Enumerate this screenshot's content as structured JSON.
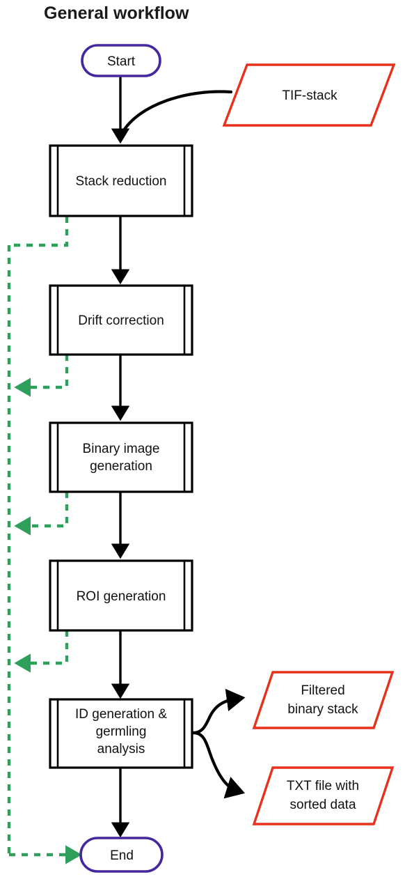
{
  "diagram": {
    "title": "General workflow",
    "type": "flowchart",
    "colors": {
      "terminator_border": "#4527a0",
      "process_border": "#000000",
      "io_border": "#e8301c",
      "loop_arrow": "#2ea05c",
      "background": "#ffffff",
      "text": "#111111"
    },
    "nodes": [
      {
        "id": "start",
        "shape": "terminator",
        "label": "Start"
      },
      {
        "id": "tif",
        "shape": "input-output",
        "label": "TIF-stack"
      },
      {
        "id": "reduce",
        "shape": "predefined-process",
        "label": "Stack reduction"
      },
      {
        "id": "drift",
        "shape": "predefined-process",
        "label": "Drift correction"
      },
      {
        "id": "binary",
        "shape": "predefined-process",
        "label_line1": "Binary image",
        "label_line2": "generation"
      },
      {
        "id": "roi",
        "shape": "predefined-process",
        "label": "ROI generation"
      },
      {
        "id": "idgen",
        "shape": "predefined-process",
        "label_line1": "ID generation &",
        "label_line2": "germling",
        "label_line3": "analysis"
      },
      {
        "id": "binout",
        "shape": "input-output",
        "label_line1": "Filtered",
        "label_line2": "binary stack"
      },
      {
        "id": "txtout",
        "shape": "input-output",
        "label_line1": "TXT file with",
        "label_line2": "sorted data"
      },
      {
        "id": "end",
        "shape": "terminator",
        "label": "End"
      }
    ],
    "edges": [
      {
        "from": "start",
        "to": "reduce",
        "style": "solid-arrow"
      },
      {
        "from": "tif",
        "to": "reduce",
        "style": "curved-arrow"
      },
      {
        "from": "reduce",
        "to": "drift",
        "style": "solid-arrow"
      },
      {
        "from": "drift",
        "to": "binary",
        "style": "solid-arrow"
      },
      {
        "from": "binary",
        "to": "roi",
        "style": "solid-arrow"
      },
      {
        "from": "roi",
        "to": "idgen",
        "style": "solid-arrow"
      },
      {
        "from": "idgen",
        "to": "end",
        "style": "solid-arrow"
      },
      {
        "from": "idgen",
        "to": "binout",
        "style": "curved-arrow"
      },
      {
        "from": "idgen",
        "to": "txtout",
        "style": "curved-arrow"
      },
      {
        "from": "reduce",
        "to": "end",
        "style": "green-dashed-bypass"
      },
      {
        "from": "drift",
        "to": "end",
        "style": "green-dashed-bypass"
      },
      {
        "from": "binary",
        "to": "end",
        "style": "green-dashed-bypass"
      },
      {
        "from": "roi",
        "to": "end",
        "style": "green-dashed-bypass"
      }
    ]
  }
}
